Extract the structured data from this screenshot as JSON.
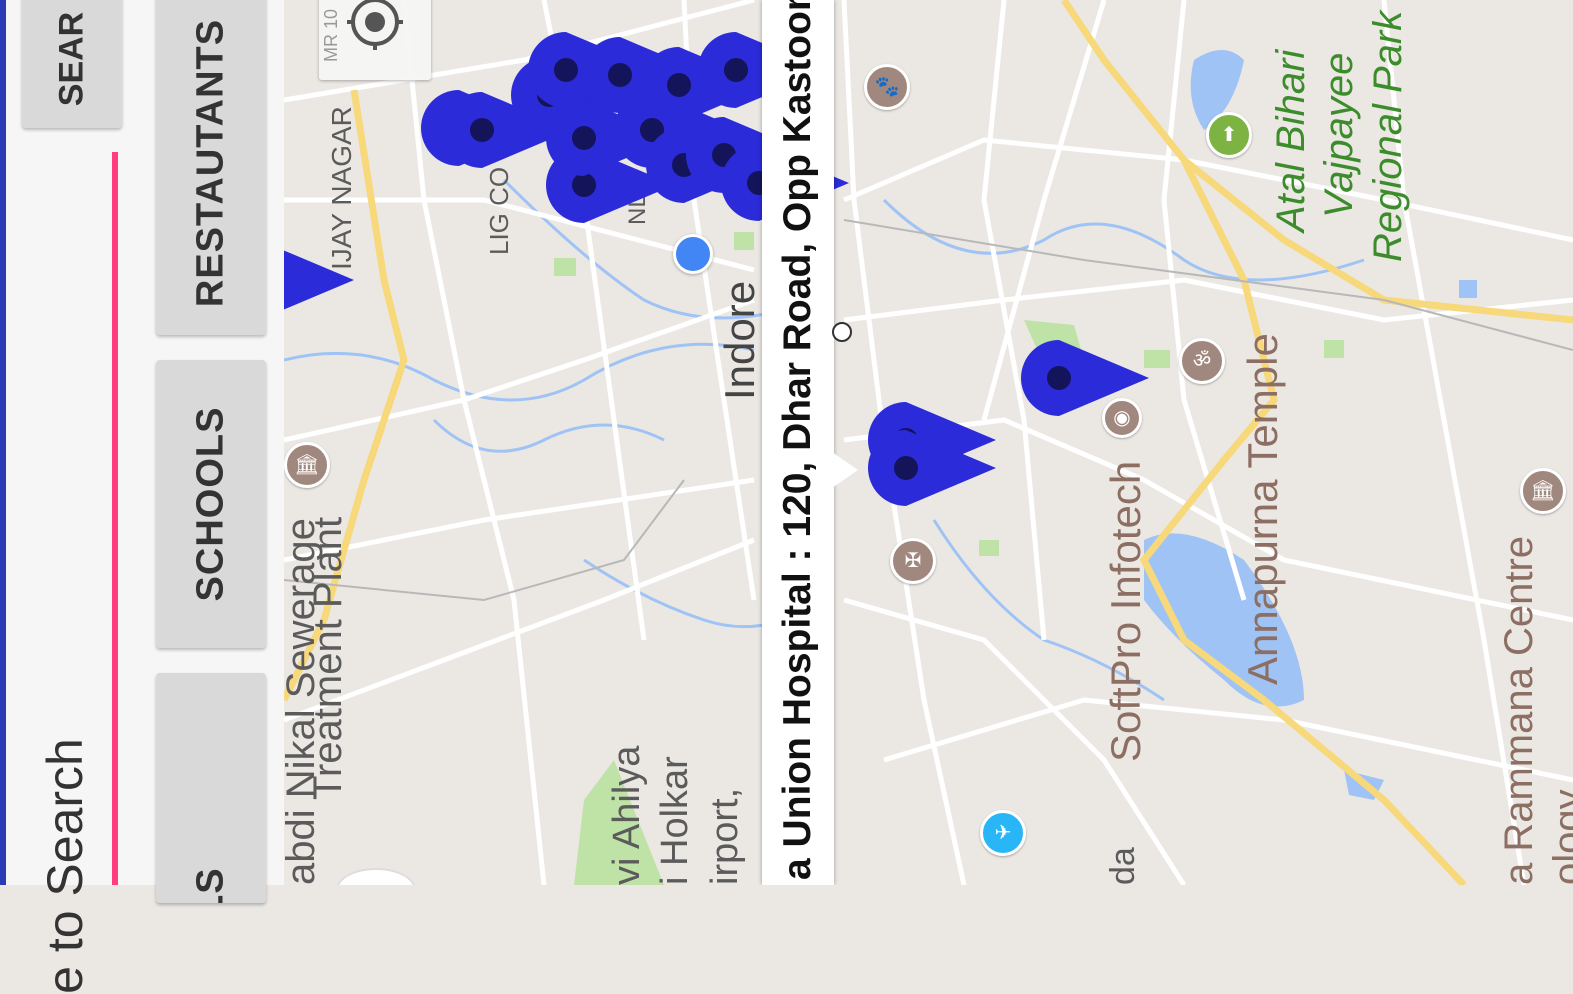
{
  "controls": {
    "search_button_label": "SEAR",
    "search_button_suffix": ": :",
    "search_placeholder": "e to Search",
    "categories": [
      {
        "label": "RESTAUTANTS"
      },
      {
        "label": "SCHOOLS"
      },
      {
        "label": "PITALS"
      }
    ]
  },
  "map": {
    "info_window_text": "a Union Hospital : 120, Dhar Road, Opp Kastoor",
    "labels": {
      "road_mr": "MR 10",
      "vijay_nagar": "IJAY NAGAR",
      "lig_colony": "LIG CO",
      "nl": "NL",
      "city": "Indore",
      "sewerage": "abdi Nikal Sewerage",
      "treatment_plant": "Treatment Plant",
      "airport_1": "vi Ahilya",
      "airport_2": "i Holkar",
      "airport_3": "irport,",
      "softpro": "SoftPro Infotech",
      "temple": "Annapurna Temple",
      "park_1": "Atal Bihari",
      "park_2": "Vajpayee",
      "park_3": "Regional Park",
      "rammana_1": "a Rammana Centre",
      "rammana_2": "ology",
      "da": "da"
    },
    "colors": {
      "marker": "#2b2bd9",
      "marker_dot": "#14145a",
      "road_major": "#f7d87a",
      "road_minor": "#ffffff",
      "water": "#9fc3f5",
      "park": "#bfe3a6",
      "accent": "#ff3d7f",
      "brand": "#2b3bb5"
    },
    "icons": [
      "my-location-icon",
      "museum-icon",
      "place-of-worship-icon",
      "park-icon",
      "airport-icon",
      "pet-icon",
      "om-temple-icon"
    ]
  }
}
